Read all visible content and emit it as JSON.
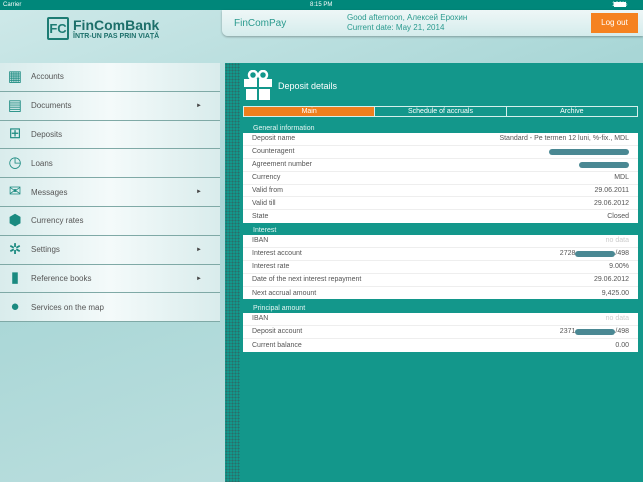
{
  "status": {
    "carrier": "Carrier",
    "time": "8:15 PM",
    "battery": "100%"
  },
  "logo": {
    "name": "FinComBank",
    "tagline": "ÎNTR-UN PAS PRIN VIAȚĂ",
    "mark": "FC"
  },
  "header": {
    "app": "FinComPay",
    "greeting": "Good afternoon, Алексей Ерохин",
    "date": "Current date: May 21, 2014",
    "logout": "Log out"
  },
  "sidebar": {
    "items": [
      {
        "label": "Accounts",
        "icon": "calculator-icon",
        "submenu": false
      },
      {
        "label": "Documents",
        "icon": "document-icon",
        "submenu": true
      },
      {
        "label": "Deposits",
        "icon": "gift-icon",
        "submenu": false
      },
      {
        "label": "Loans",
        "icon": "clock-icon",
        "submenu": false
      },
      {
        "label": "Messages",
        "icon": "envelope-icon",
        "submenu": true
      },
      {
        "label": "Currency rates",
        "icon": "coins-icon",
        "submenu": false
      },
      {
        "label": "Settings",
        "icon": "gears-icon",
        "submenu": true
      },
      {
        "label": "Reference books",
        "icon": "book-icon",
        "submenu": true
      },
      {
        "label": "Services on the map",
        "icon": "globe-icon",
        "submenu": false
      }
    ]
  },
  "detail": {
    "title": "Deposit details",
    "tabs": [
      {
        "label": "Main",
        "active": true
      },
      {
        "label": "Schedule of accruals"
      },
      {
        "label": "Archive"
      }
    ],
    "general": {
      "label": "General information",
      "rows": [
        {
          "k": "Deposit name",
          "v": "Standard - Pe termen 12 luni, %-fix., MDL"
        },
        {
          "k": "Counteragent",
          "v": ""
        },
        {
          "k": "Agreement number",
          "v": ""
        },
        {
          "k": "Currency",
          "v": "MDL"
        },
        {
          "k": "Valid from",
          "v": "29.06.2011"
        },
        {
          "k": "Valid till",
          "v": "29.06.2012"
        },
        {
          "k": "State",
          "v": "Closed"
        }
      ]
    },
    "interest": {
      "label": "Interest",
      "rows": [
        {
          "k": "IBAN",
          "v": "no data"
        },
        {
          "k": "Interest account",
          "v": "2728",
          "v2": "/498"
        },
        {
          "k": "Interest rate",
          "v": "9.00%"
        },
        {
          "k": "Date of the next interest repayment",
          "v": "29.06.2012"
        },
        {
          "k": "Next accrual amount",
          "v": "9,425.00"
        }
      ]
    },
    "principal": {
      "label": "Principal amount",
      "rows": [
        {
          "k": "IBAN",
          "v": "no data"
        },
        {
          "k": "Deposit account",
          "v": "2371",
          "v2": "/498"
        },
        {
          "k": "Current balance",
          "v": "0.00"
        }
      ]
    }
  },
  "colors": {
    "teal": "#13978b",
    "orange": "#f58220",
    "status": "#00877a"
  }
}
